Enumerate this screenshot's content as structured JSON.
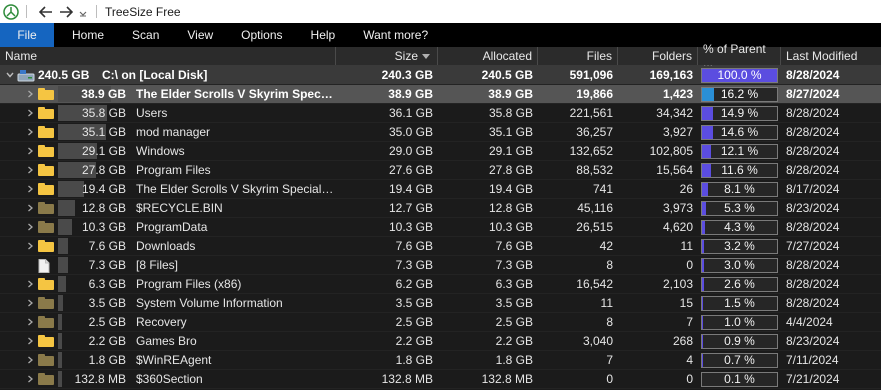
{
  "titlebar": {
    "app_title": "TreeSize Free"
  },
  "menu": [
    "File",
    "Home",
    "Scan",
    "View",
    "Options",
    "Help",
    "Want more?"
  ],
  "columns": {
    "name": "Name",
    "size": "Size",
    "allocated": "Allocated",
    "files": "Files",
    "folders": "Folders",
    "percent": "% of Parent ...",
    "modified": "Last Modified"
  },
  "colors": {
    "accent": "#1565c0",
    "pct_fill": "#5b4de0",
    "folder_yellow": "#f5c542",
    "folder_dim": "#8a7a4a"
  },
  "root": {
    "size_label": "240.5 GB",
    "name": "C:\\  on  [Local Disk]",
    "size": "240.3 GB",
    "allocated": "240.5 GB",
    "files": "591,096",
    "folders": "169,163",
    "percent": "100.0 %",
    "percent_value": 100.0,
    "modified": "8/28/2024"
  },
  "rows": [
    {
      "size_label": "38.9 GB",
      "name": "The Elder Scrolls V Skyrim Special ...",
      "size": "38.9 GB",
      "allocated": "38.9 GB",
      "files": "19,866",
      "folders": "1,423",
      "percent": "16.2 %",
      "percent_value": 16.2,
      "modified": "8/27/2024",
      "icon": "folder-icon",
      "selected": true
    },
    {
      "size_label": "35.8 GB",
      "name": "Users",
      "size": "36.1 GB",
      "allocated": "35.8 GB",
      "files": "221,561",
      "folders": "34,342",
      "percent": "14.9 %",
      "percent_value": 14.9,
      "modified": "8/28/2024",
      "icon": "folder-icon"
    },
    {
      "size_label": "35.1 GB",
      "name": "mod manager",
      "size": "35.0 GB",
      "allocated": "35.1 GB",
      "files": "36,257",
      "folders": "3,927",
      "percent": "14.6 %",
      "percent_value": 14.6,
      "modified": "8/28/2024",
      "icon": "folder-icon"
    },
    {
      "size_label": "29.1 GB",
      "name": "Windows",
      "size": "29.0 GB",
      "allocated": "29.1 GB",
      "files": "132,652",
      "folders": "102,805",
      "percent": "12.1 %",
      "percent_value": 12.1,
      "modified": "8/28/2024",
      "icon": "folder-icon"
    },
    {
      "size_label": "27.8 GB",
      "name": "Program Files",
      "size": "27.6 GB",
      "allocated": "27.8 GB",
      "files": "88,532",
      "folders": "15,564",
      "percent": "11.6 %",
      "percent_value": 11.6,
      "modified": "8/28/2024",
      "icon": "folder-icon"
    },
    {
      "size_label": "19.4 GB",
      "name": "The Elder Scrolls V Skyrim Special E...",
      "size": "19.4 GB",
      "allocated": "19.4 GB",
      "files": "741",
      "folders": "26",
      "percent": "8.1 %",
      "percent_value": 8.1,
      "modified": "8/17/2024",
      "icon": "folder-icon"
    },
    {
      "size_label": "12.8 GB",
      "name": "$RECYCLE.BIN",
      "size": "12.7 GB",
      "allocated": "12.8 GB",
      "files": "45,116",
      "folders": "3,973",
      "percent": "5.3 %",
      "percent_value": 5.3,
      "modified": "8/23/2024",
      "icon": "folder-dim-icon"
    },
    {
      "size_label": "10.3 GB",
      "name": "ProgramData",
      "size": "10.3 GB",
      "allocated": "10.3 GB",
      "files": "26,515",
      "folders": "4,620",
      "percent": "4.3 %",
      "percent_value": 4.3,
      "modified": "8/28/2024",
      "icon": "folder-dim-icon"
    },
    {
      "size_label": "7.6 GB",
      "name": "Downloads",
      "size": "7.6 GB",
      "allocated": "7.6 GB",
      "files": "42",
      "folders": "11",
      "percent": "3.2 %",
      "percent_value": 3.2,
      "modified": "7/27/2024",
      "icon": "folder-icon"
    },
    {
      "size_label": "7.3 GB",
      "name": "[8 Files]",
      "size": "7.3 GB",
      "allocated": "7.3 GB",
      "files": "8",
      "folders": "0",
      "percent": "3.0 %",
      "percent_value": 3.0,
      "modified": "8/28/2024",
      "icon": "file-icon",
      "no_expand": true
    },
    {
      "size_label": "6.3 GB",
      "name": "Program Files (x86)",
      "size": "6.2 GB",
      "allocated": "6.3 GB",
      "files": "16,542",
      "folders": "2,103",
      "percent": "2.6 %",
      "percent_value": 2.6,
      "modified": "8/28/2024",
      "icon": "folder-icon"
    },
    {
      "size_label": "3.5 GB",
      "name": "System Volume Information",
      "size": "3.5 GB",
      "allocated": "3.5 GB",
      "files": "11",
      "folders": "15",
      "percent": "1.5 %",
      "percent_value": 1.5,
      "modified": "8/28/2024",
      "icon": "folder-dim-icon"
    },
    {
      "size_label": "2.5 GB",
      "name": "Recovery",
      "size": "2.5 GB",
      "allocated": "2.5 GB",
      "files": "8",
      "folders": "7",
      "percent": "1.0 %",
      "percent_value": 1.0,
      "modified": "4/4/2024",
      "icon": "folder-dim-icon"
    },
    {
      "size_label": "2.2 GB",
      "name": "Games Bro",
      "size": "2.2 GB",
      "allocated": "2.2 GB",
      "files": "3,040",
      "folders": "268",
      "percent": "0.9 %",
      "percent_value": 0.9,
      "modified": "8/23/2024",
      "icon": "folder-icon"
    },
    {
      "size_label": "1.8 GB",
      "name": "$WinREAgent",
      "size": "1.8 GB",
      "allocated": "1.8 GB",
      "files": "7",
      "folders": "4",
      "percent": "0.7 %",
      "percent_value": 0.7,
      "modified": "7/11/2024",
      "icon": "folder-dim-icon"
    },
    {
      "size_label": "132.8 MB",
      "name": "$360Section",
      "size": "132.8 MB",
      "allocated": "132.8 MB",
      "files": "0",
      "folders": "0",
      "percent": "0.1 %",
      "percent_value": 0.1,
      "modified": "7/21/2024",
      "icon": "folder-dim-icon"
    }
  ]
}
